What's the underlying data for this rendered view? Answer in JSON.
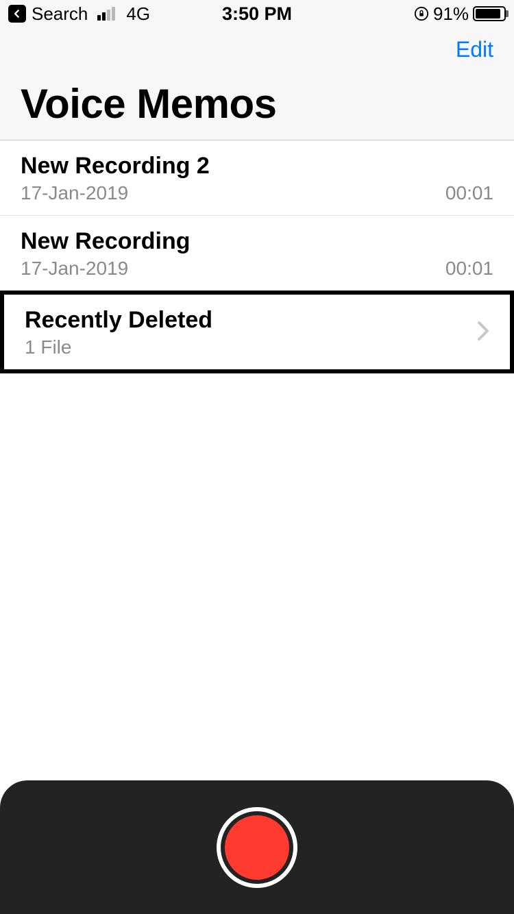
{
  "statusbar": {
    "back_label": "Search",
    "network": "4G",
    "time": "3:50 PM",
    "battery_percent": "91%"
  },
  "nav": {
    "edit": "Edit"
  },
  "title": "Voice Memos",
  "recordings": [
    {
      "title": "New Recording 2",
      "date": "17-Jan-2019",
      "duration": "00:01"
    },
    {
      "title": "New Recording",
      "date": "17-Jan-2019",
      "duration": "00:01"
    }
  ],
  "deleted": {
    "title": "Recently Deleted",
    "subtitle": "1 File"
  }
}
